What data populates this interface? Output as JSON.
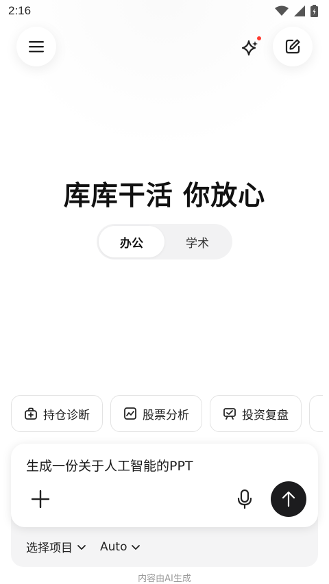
{
  "status_bar": {
    "time": "2:16",
    "icons": [
      "wifi-icon",
      "signal-icon",
      "battery-icon"
    ]
  },
  "header": {
    "menu_icon": "hamburger-menu-icon",
    "sparkle_icon": "sparkle-icon",
    "new_chat_icon": "edit-icon",
    "notification_dot_color": "#ff3b30"
  },
  "main": {
    "headline": "库库干活 你放心",
    "tabs": [
      {
        "label": "办公",
        "active": true
      },
      {
        "label": "学术",
        "active": false
      }
    ]
  },
  "chips": [
    {
      "label": "持仓诊断",
      "icon": "portfolio-icon"
    },
    {
      "label": "股票分析",
      "icon": "chart-icon"
    },
    {
      "label": "投资复盘",
      "icon": "review-icon"
    }
  ],
  "composer": {
    "input_value": "生成一份关于人工智能的PPT",
    "add_icon": "plus-icon",
    "mic_icon": "microphone-icon",
    "send_icon": "arrow-up-icon",
    "project_select": "选择项目",
    "model_select": "Auto"
  },
  "footer": {
    "disclaimer": "内容由AI生成"
  }
}
